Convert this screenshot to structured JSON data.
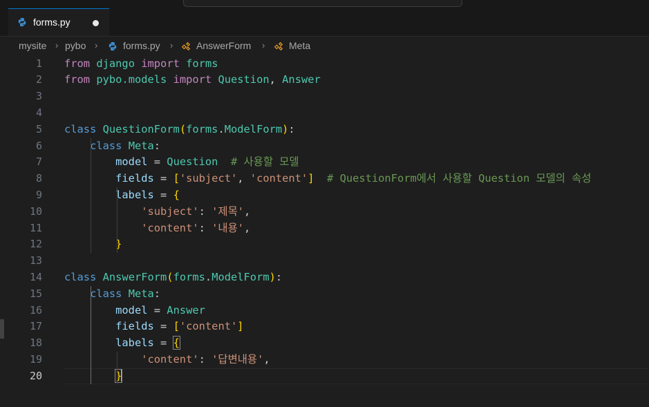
{
  "tab": {
    "filename": "forms.py",
    "icon": "python-file-icon"
  },
  "breadcrumb": {
    "items": [
      "mysite",
      "pybo",
      "forms.py",
      "AnswerForm",
      "Meta"
    ]
  },
  "editor": {
    "line_numbers": [
      "1",
      "2",
      "3",
      "4",
      "5",
      "6",
      "7",
      "8",
      "9",
      "10",
      "11",
      "12",
      "13",
      "14",
      "15",
      "16",
      "17",
      "18",
      "19",
      "20"
    ],
    "active_line": "20",
    "lines": [
      [
        [
          "kc",
          "from"
        ],
        [
          "w",
          " "
        ],
        [
          "cl",
          "django"
        ],
        [
          "w",
          " "
        ],
        [
          "kc",
          "import"
        ],
        [
          "w",
          " "
        ],
        [
          "cl",
          "forms"
        ]
      ],
      [
        [
          "kc",
          "from"
        ],
        [
          "w",
          " "
        ],
        [
          "cl",
          "pybo.models"
        ],
        [
          "w",
          " "
        ],
        [
          "kc",
          "import"
        ],
        [
          "w",
          " "
        ],
        [
          "cl",
          "Question"
        ],
        [
          "w",
          ", "
        ],
        [
          "cl",
          "Answer"
        ]
      ],
      [],
      [],
      [
        [
          "k",
          "class"
        ],
        [
          "w",
          " "
        ],
        [
          "cl",
          "QuestionForm"
        ],
        [
          "b1",
          "("
        ],
        [
          "cl",
          "forms"
        ],
        [
          "w",
          "."
        ],
        [
          "cl",
          "ModelForm"
        ],
        [
          "b1",
          ")"
        ],
        [
          "w",
          ":"
        ]
      ],
      [
        [
          "w",
          "    "
        ],
        [
          "k",
          "class"
        ],
        [
          "w",
          " "
        ],
        [
          "cl",
          "Meta"
        ],
        [
          "w",
          ":"
        ]
      ],
      [
        [
          "w",
          "        "
        ],
        [
          "pl",
          "model"
        ],
        [
          "w",
          " = "
        ],
        [
          "cl",
          "Question"
        ],
        [
          "w",
          "  "
        ],
        [
          "cm",
          "# 사용할 모델"
        ]
      ],
      [
        [
          "w",
          "        "
        ],
        [
          "pl",
          "fields"
        ],
        [
          "w",
          " = "
        ],
        [
          "b1",
          "["
        ],
        [
          "st",
          "'subject'"
        ],
        [
          "w",
          ", "
        ],
        [
          "st",
          "'content'"
        ],
        [
          "b1",
          "]"
        ],
        [
          "w",
          "  "
        ],
        [
          "cm",
          "# QuestionForm에서 사용할 Question 모델의 속성"
        ]
      ],
      [
        [
          "w",
          "        "
        ],
        [
          "pl",
          "labels"
        ],
        [
          "w",
          " = "
        ],
        [
          "b1",
          "{"
        ]
      ],
      [
        [
          "w",
          "            "
        ],
        [
          "st",
          "'subject'"
        ],
        [
          "w",
          ": "
        ],
        [
          "st",
          "'제목'"
        ],
        [
          "w",
          ","
        ]
      ],
      [
        [
          "w",
          "            "
        ],
        [
          "st",
          "'content'"
        ],
        [
          "w",
          ": "
        ],
        [
          "st",
          "'내용'"
        ],
        [
          "w",
          ","
        ]
      ],
      [
        [
          "w",
          "        "
        ],
        [
          "b1",
          "}"
        ]
      ],
      [],
      [
        [
          "k",
          "class"
        ],
        [
          "w",
          " "
        ],
        [
          "cl",
          "AnswerForm"
        ],
        [
          "b1",
          "("
        ],
        [
          "cl",
          "forms"
        ],
        [
          "w",
          "."
        ],
        [
          "cl",
          "ModelForm"
        ],
        [
          "b1",
          ")"
        ],
        [
          "w",
          ":"
        ]
      ],
      [
        [
          "w",
          "    "
        ],
        [
          "k",
          "class"
        ],
        [
          "w",
          " "
        ],
        [
          "cl",
          "Meta"
        ],
        [
          "w",
          ":"
        ]
      ],
      [
        [
          "w",
          "        "
        ],
        [
          "pl",
          "model"
        ],
        [
          "w",
          " = "
        ],
        [
          "cl",
          "Answer"
        ]
      ],
      [
        [
          "w",
          "        "
        ],
        [
          "pl",
          "fields"
        ],
        [
          "w",
          " = "
        ],
        [
          "b1",
          "["
        ],
        [
          "st",
          "'content'"
        ],
        [
          "b1",
          "]"
        ]
      ],
      [
        [
          "w",
          "        "
        ],
        [
          "pl",
          "labels"
        ],
        [
          "w",
          " = "
        ],
        [
          "b1",
          "{"
        ]
      ],
      [
        [
          "w",
          "            "
        ],
        [
          "st",
          "'content'"
        ],
        [
          "w",
          ": "
        ],
        [
          "st",
          "'답변내용'"
        ],
        [
          "w",
          ","
        ]
      ],
      [
        [
          "w",
          "        "
        ],
        [
          "b1",
          "}"
        ]
      ]
    ]
  }
}
